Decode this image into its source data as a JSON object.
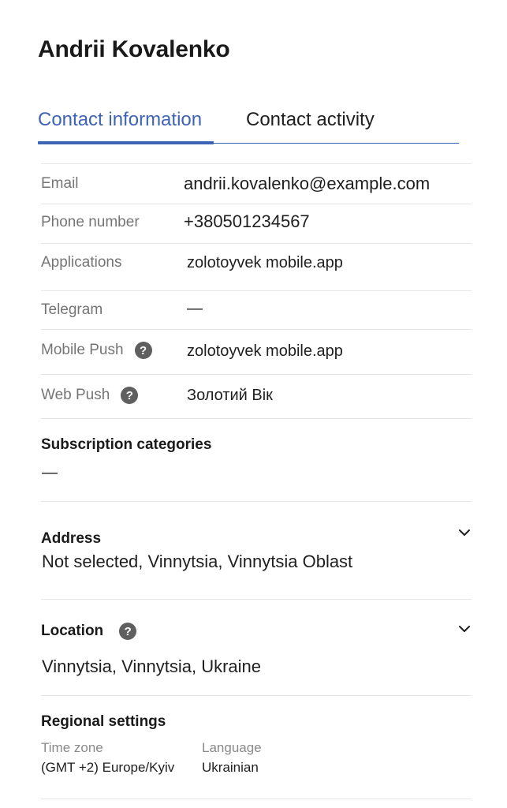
{
  "contact": {
    "name": "Andrii Kovalenko"
  },
  "tabs": [
    {
      "label": "Contact information",
      "active": true
    },
    {
      "label": "Contact activity",
      "active": false
    }
  ],
  "fields": {
    "email": {
      "label": "Email",
      "value": "andrii.kovalenko@example.com"
    },
    "phone": {
      "label": "Phone number",
      "value": "+380501234567"
    },
    "applications": {
      "label": "Applications",
      "value": "zolotoyvek mobile.app"
    },
    "telegram": {
      "label": "Telegram",
      "value": "—"
    },
    "mobile_push": {
      "label": "Mobile Push",
      "value": "zolotoyvek mobile.app"
    },
    "web_push": {
      "label": "Web Push",
      "value": "Золотий Вік"
    }
  },
  "subscription": {
    "title": "Subscription categories",
    "value": "—"
  },
  "address": {
    "title": "Address",
    "value": "Not selected, Vinnytsia, Vinnytsia Oblast"
  },
  "location": {
    "title": "Location",
    "value": "Vinnytsia, Vinnytsia, Ukraine"
  },
  "regional": {
    "title": "Regional settings",
    "timezone_label": "Time zone",
    "timezone_value": "(GMT +2) Europe/Kyiv",
    "language_label": "Language",
    "language_value": "Ukrainian"
  },
  "icons": {
    "help": "help-icon",
    "chevron": "chevron-down-icon"
  },
  "colors": {
    "accent": "#3f63b5",
    "muted": "#757575",
    "divider": "#e6e6e6"
  }
}
